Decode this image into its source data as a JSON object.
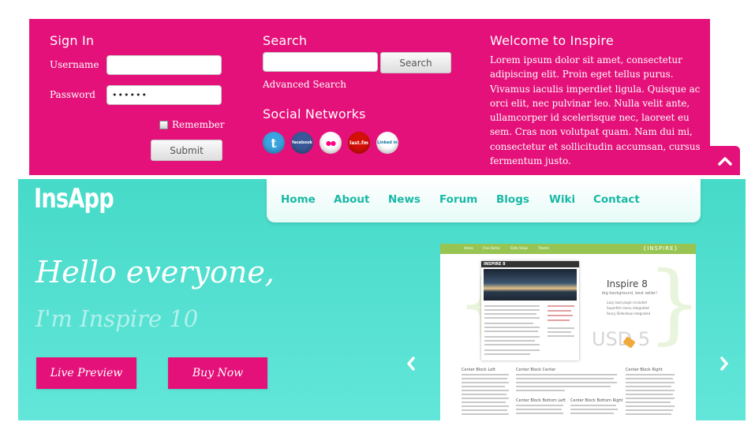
{
  "sign_in": {
    "heading": "Sign In",
    "username_label": "Username",
    "username_value": "",
    "password_label": "Password",
    "password_value": "••••••",
    "remember_label": "Remember",
    "remember_checked": false,
    "submit_label": "Submit"
  },
  "search": {
    "heading": "Search",
    "input_value": "",
    "button_label": "Search",
    "advanced_link": "Advanced Search"
  },
  "social": {
    "heading": "Social Networks",
    "networks": [
      {
        "label": "t",
        "icon": "twitter-icon",
        "color": "#3aa3e0"
      },
      {
        "label": "facebook",
        "icon": "facebook-icon",
        "color": "#3b5998"
      },
      {
        "label": "●●",
        "icon": "flickr-icon",
        "color": "#2b2f6e"
      },
      {
        "label": "last.fm",
        "icon": "lastfm-icon",
        "color": "#d51007"
      },
      {
        "label": "Linked in",
        "icon": "linkedin-icon",
        "color": "#ffffff"
      }
    ]
  },
  "welcome": {
    "heading": "Welcome to Inspire",
    "body": "Lorem ipsum dolor sit amet, consectetur adipiscing elit. Proin eget tellus purus. Vivamus iaculis imperdiet ligula. Quisque ac orci elit, nec pulvinar leo. Nulla velit ante, ullamcorper id scelerisque nec, laoreet eu sem. Cras non volutpat quam. Nam dui mi, consectetur et sollicitudin accumsan, cursus fermentum justo."
  },
  "colors": {
    "brand_pink": "#e5117a",
    "hero_teal": "#4fe0cf",
    "nav_link": "#19b8a6"
  },
  "header": {
    "logo": "InsApp",
    "nav": [
      "Home",
      "About",
      "News",
      "Forum",
      "Blogs",
      "Wiki",
      "Contact"
    ]
  },
  "hero": {
    "headline": "Hello everyone,",
    "subline": "I'm Inspire 10",
    "primary_button": "Live Preview",
    "secondary_button": "Buy Now"
  },
  "slide": {
    "brand": "{INSPIRE}",
    "mini_nav": [
      "Home",
      "Free Demo",
      "Slide Show",
      "Theme"
    ],
    "site_brand": "INSPIRE 8",
    "title": "Inspire 8",
    "tagline": "big background, best seller!",
    "features": [
      "Lazy load plugin included",
      "Superfish menu integrated",
      "Fancy Slideshow integrated"
    ],
    "price": "USD 5",
    "columns": [
      "Center Block Left",
      "Center Block Center",
      "Center Block Bottom Left",
      "Center Block Bottom Right",
      "Center Block Right"
    ]
  }
}
